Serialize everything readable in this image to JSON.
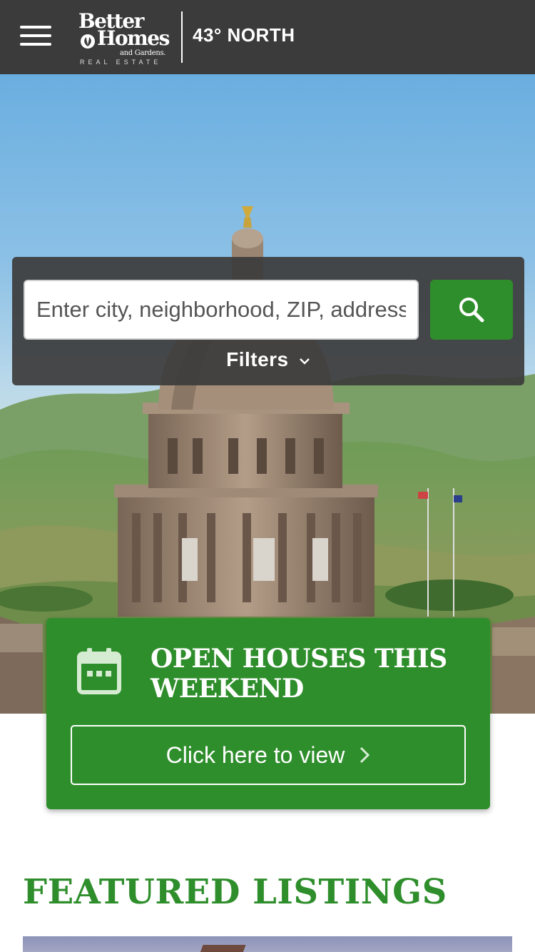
{
  "header": {
    "menu_icon": "hamburger-menu-icon",
    "logo": {
      "line1": "Better",
      "line2": "Homes",
      "line3": "and Gardens.",
      "line4": "REAL ESTATE"
    },
    "brand_suffix": "43° NORTH"
  },
  "search": {
    "placeholder": "Enter city, neighborhood, ZIP, address",
    "button_icon": "search-icon",
    "filters_label": "Filters"
  },
  "open_houses": {
    "icon": "calendar-icon",
    "title": "OPEN HOUSES THIS WEEKEND",
    "button_label": "Click here to view"
  },
  "featured": {
    "title": "FEATURED LISTINGS"
  },
  "colors": {
    "header_bg": "#3b3b3b",
    "brand_green": "#2f8e2c",
    "panel_bg": "#3c3c3c"
  }
}
